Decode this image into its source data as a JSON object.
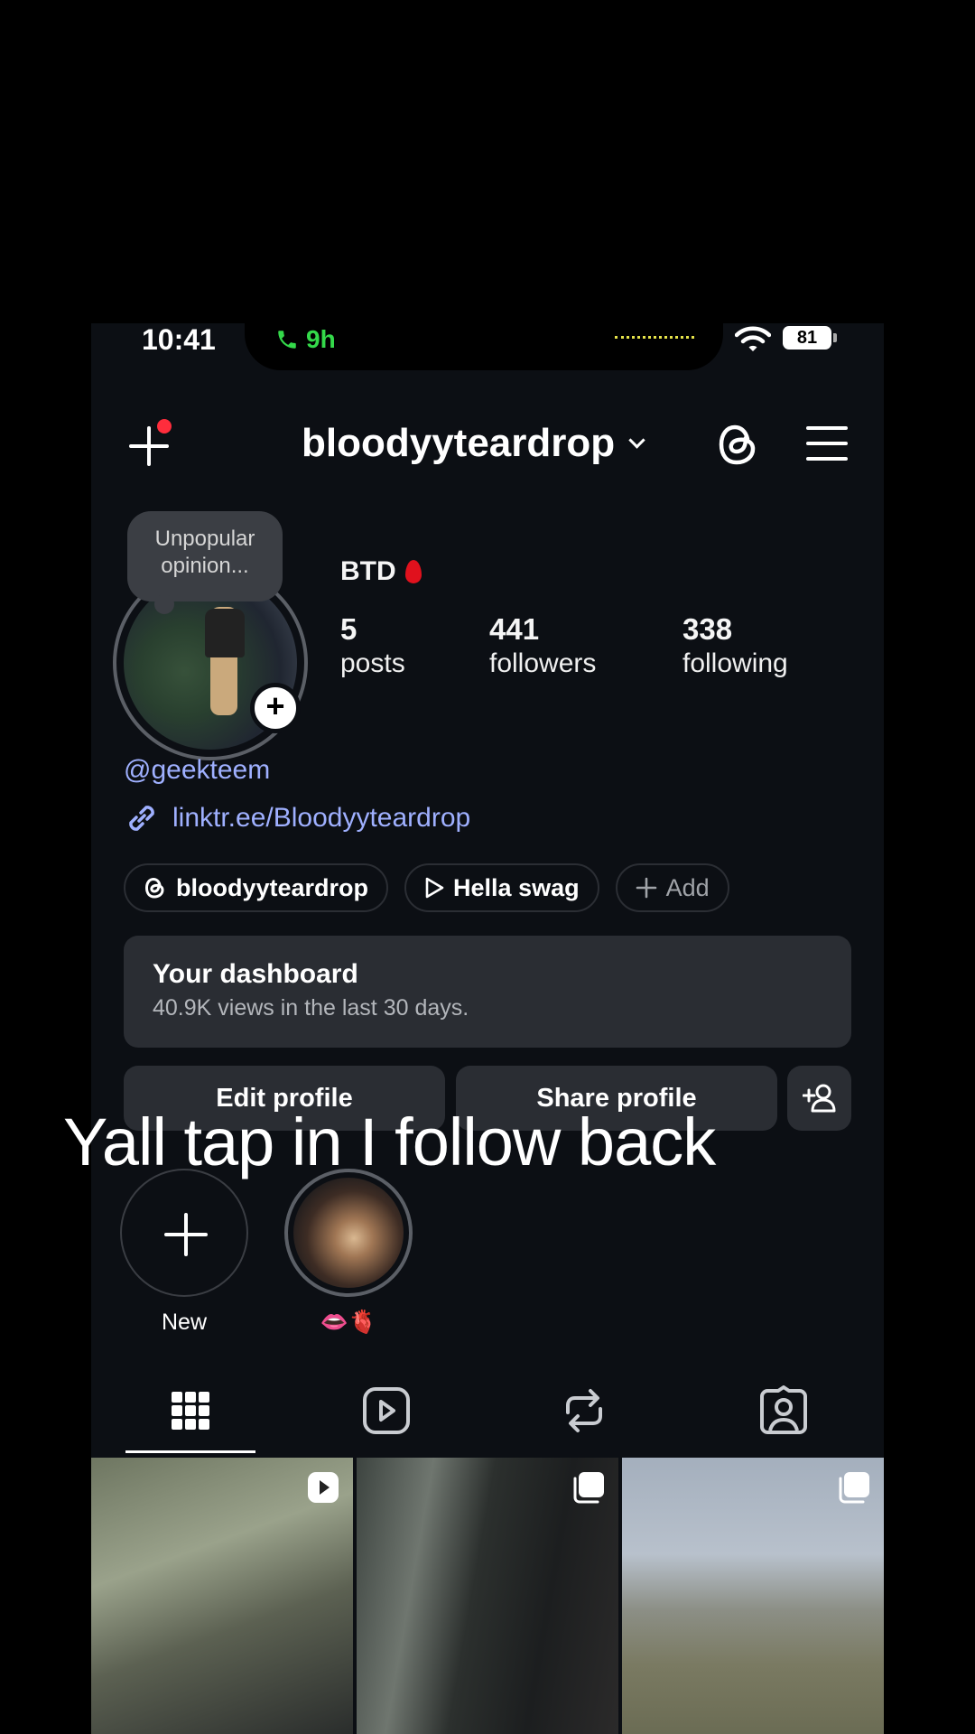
{
  "status_bar": {
    "time": "10:41",
    "call_duration": "9h",
    "battery": "81"
  },
  "header": {
    "username": "bloodyyteardrop"
  },
  "profile": {
    "note": "Unpopular opinion...",
    "display_name": "BTD",
    "stats": {
      "posts": {
        "value": "5",
        "label": "posts"
      },
      "followers": {
        "value": "441",
        "label": "followers"
      },
      "following": {
        "value": "338",
        "label": "following"
      }
    },
    "mention": "@geekteem",
    "link": "linktr.ee/Bloodyyteardrop"
  },
  "pills": {
    "threads": "bloodyyteardrop",
    "music": "Hella swag",
    "add": "Add"
  },
  "dashboard": {
    "title": "Your dashboard",
    "subtitle": "40.9K views in the last 30 days."
  },
  "buttons": {
    "edit": "Edit profile",
    "share": "Share profile"
  },
  "highlights": {
    "new_label": "New",
    "story_label": "👄🫀"
  },
  "tabs": [
    "posts-grid",
    "reels",
    "reposts",
    "tagged"
  ],
  "caption": "Yall tap in I follow back",
  "colors": {
    "background": "#0c0f14",
    "link": "#9fb0ff",
    "call_green": "#34d94a",
    "notification_red": "#ff2d3c"
  }
}
